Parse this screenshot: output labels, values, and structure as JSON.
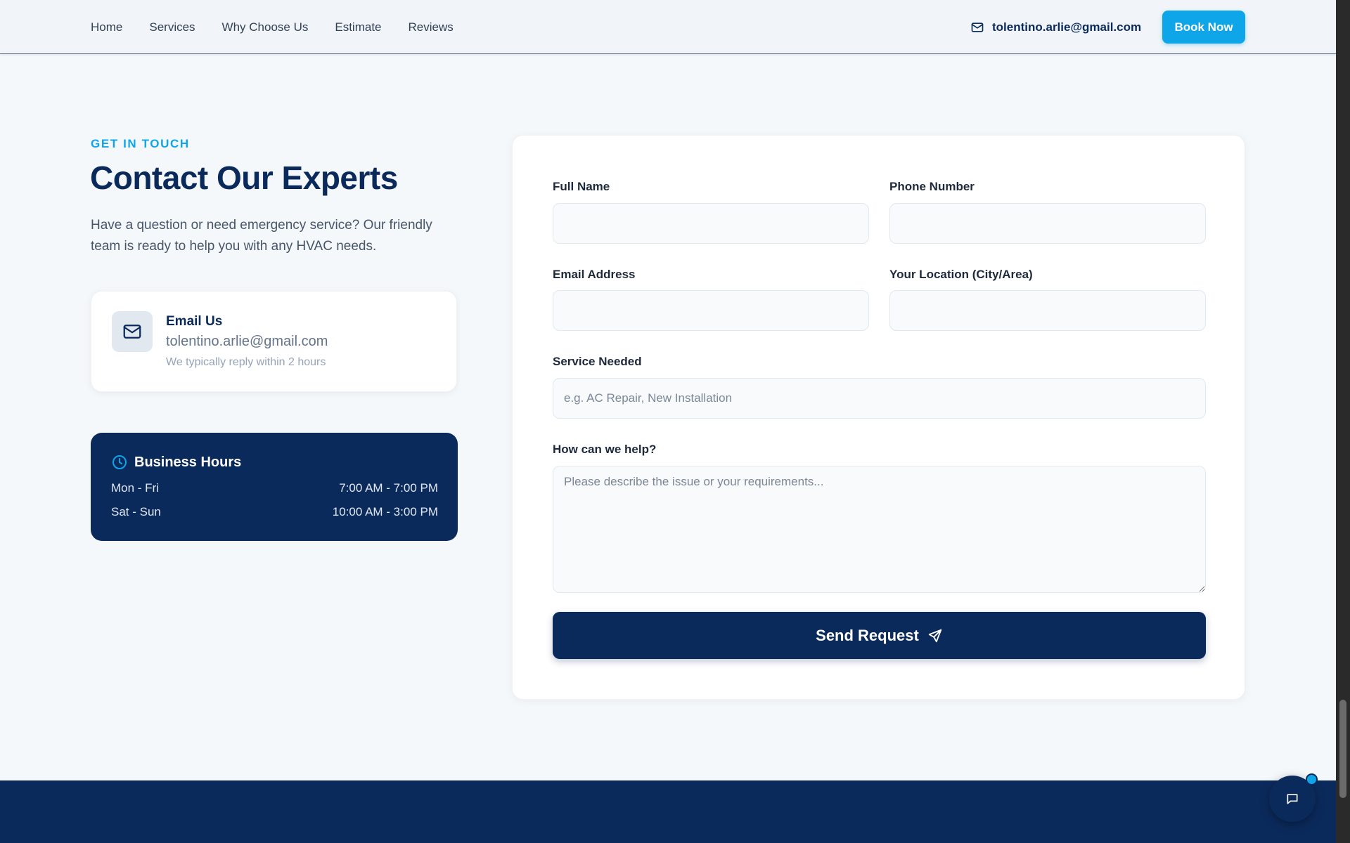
{
  "nav": {
    "links": [
      "Home",
      "Services",
      "Why Choose Us",
      "Estimate",
      "Reviews"
    ],
    "email": "tolentino.arlie@gmail.com",
    "book_label": "Book Now"
  },
  "contact": {
    "eyebrow": "GET IN TOUCH",
    "title": "Contact Our Experts",
    "intro": "Have a question or need emergency service? Our friendly team is ready to help you with any HVAC needs.",
    "email_card": {
      "title": "Email Us",
      "email": "tolentino.arlie@gmail.com",
      "note": "We typically reply within 2 hours"
    },
    "hours": {
      "title": "Business Hours",
      "rows": [
        {
          "days": "Mon - Fri",
          "time": "7:00 AM - 7:00 PM"
        },
        {
          "days": "Sat - Sun",
          "time": "10:00 AM - 3:00 PM"
        }
      ]
    }
  },
  "form": {
    "full_name": {
      "label": "Full Name",
      "value": "",
      "placeholder": ""
    },
    "phone": {
      "label": "Phone Number",
      "value": "",
      "placeholder": ""
    },
    "email": {
      "label": "Email Address",
      "value": "",
      "placeholder": ""
    },
    "location": {
      "label": "Your Location (City/Area)",
      "value": "",
      "placeholder": ""
    },
    "service": {
      "label": "Service Needed",
      "value": "",
      "placeholder": "e.g. AC Repair, New Installation"
    },
    "message": {
      "label": "How can we help?",
      "value": "",
      "placeholder": "Please describe the issue or your requirements..."
    },
    "submit_label": "Send Request"
  },
  "icons": {
    "header_email": "mail-icon",
    "email_card": "mail-icon",
    "hours": "clock-icon",
    "submit": "send-icon",
    "chat": "chat-bubble-icon"
  },
  "colors": {
    "navy": "#0b2a5c",
    "accent": "#0ea5e9",
    "page_bg": "#f5f8fb",
    "header_bg": "#f1f5f9"
  }
}
